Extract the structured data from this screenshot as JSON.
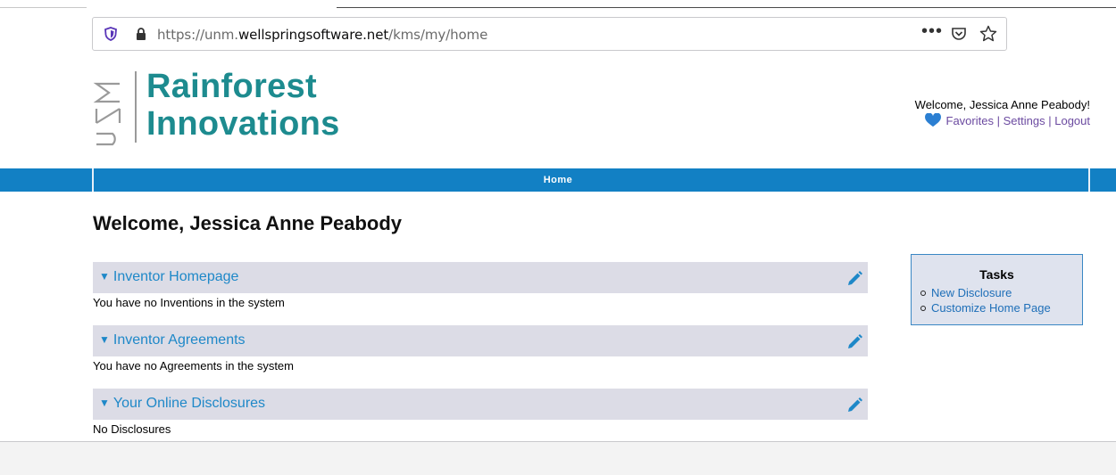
{
  "browser": {
    "url_prefix": "https://unm.",
    "url_domain": "wellspringsoftware.net",
    "url_path": "/kms/my/home",
    "more_label": "•••"
  },
  "header": {
    "logo_line1": "Rainforest",
    "logo_line2": "Innovations",
    "welcome": "Welcome, Jessica Anne Peabody!",
    "links": {
      "favorites": "Favorites",
      "settings": "Settings",
      "logout": "Logout",
      "separator": "|"
    }
  },
  "nav": {
    "home": "Home"
  },
  "page": {
    "title": "Welcome, Jessica Anne Peabody"
  },
  "sections": [
    {
      "title": "Inventor Homepage",
      "message": "You have no Inventions in the system"
    },
    {
      "title": "Inventor Agreements",
      "message": "You have no Agreements in the system"
    },
    {
      "title": "Your Online Disclosures",
      "message": "No Disclosures"
    }
  ],
  "tasks": {
    "title": "Tasks",
    "items": [
      "New Disclosure",
      "Customize Home Page"
    ]
  },
  "colors": {
    "brand_teal": "#1d8b8f",
    "nav_blue": "#1280c4",
    "link_blue": "#1e88c8",
    "link_purple": "#6b4aa0"
  }
}
